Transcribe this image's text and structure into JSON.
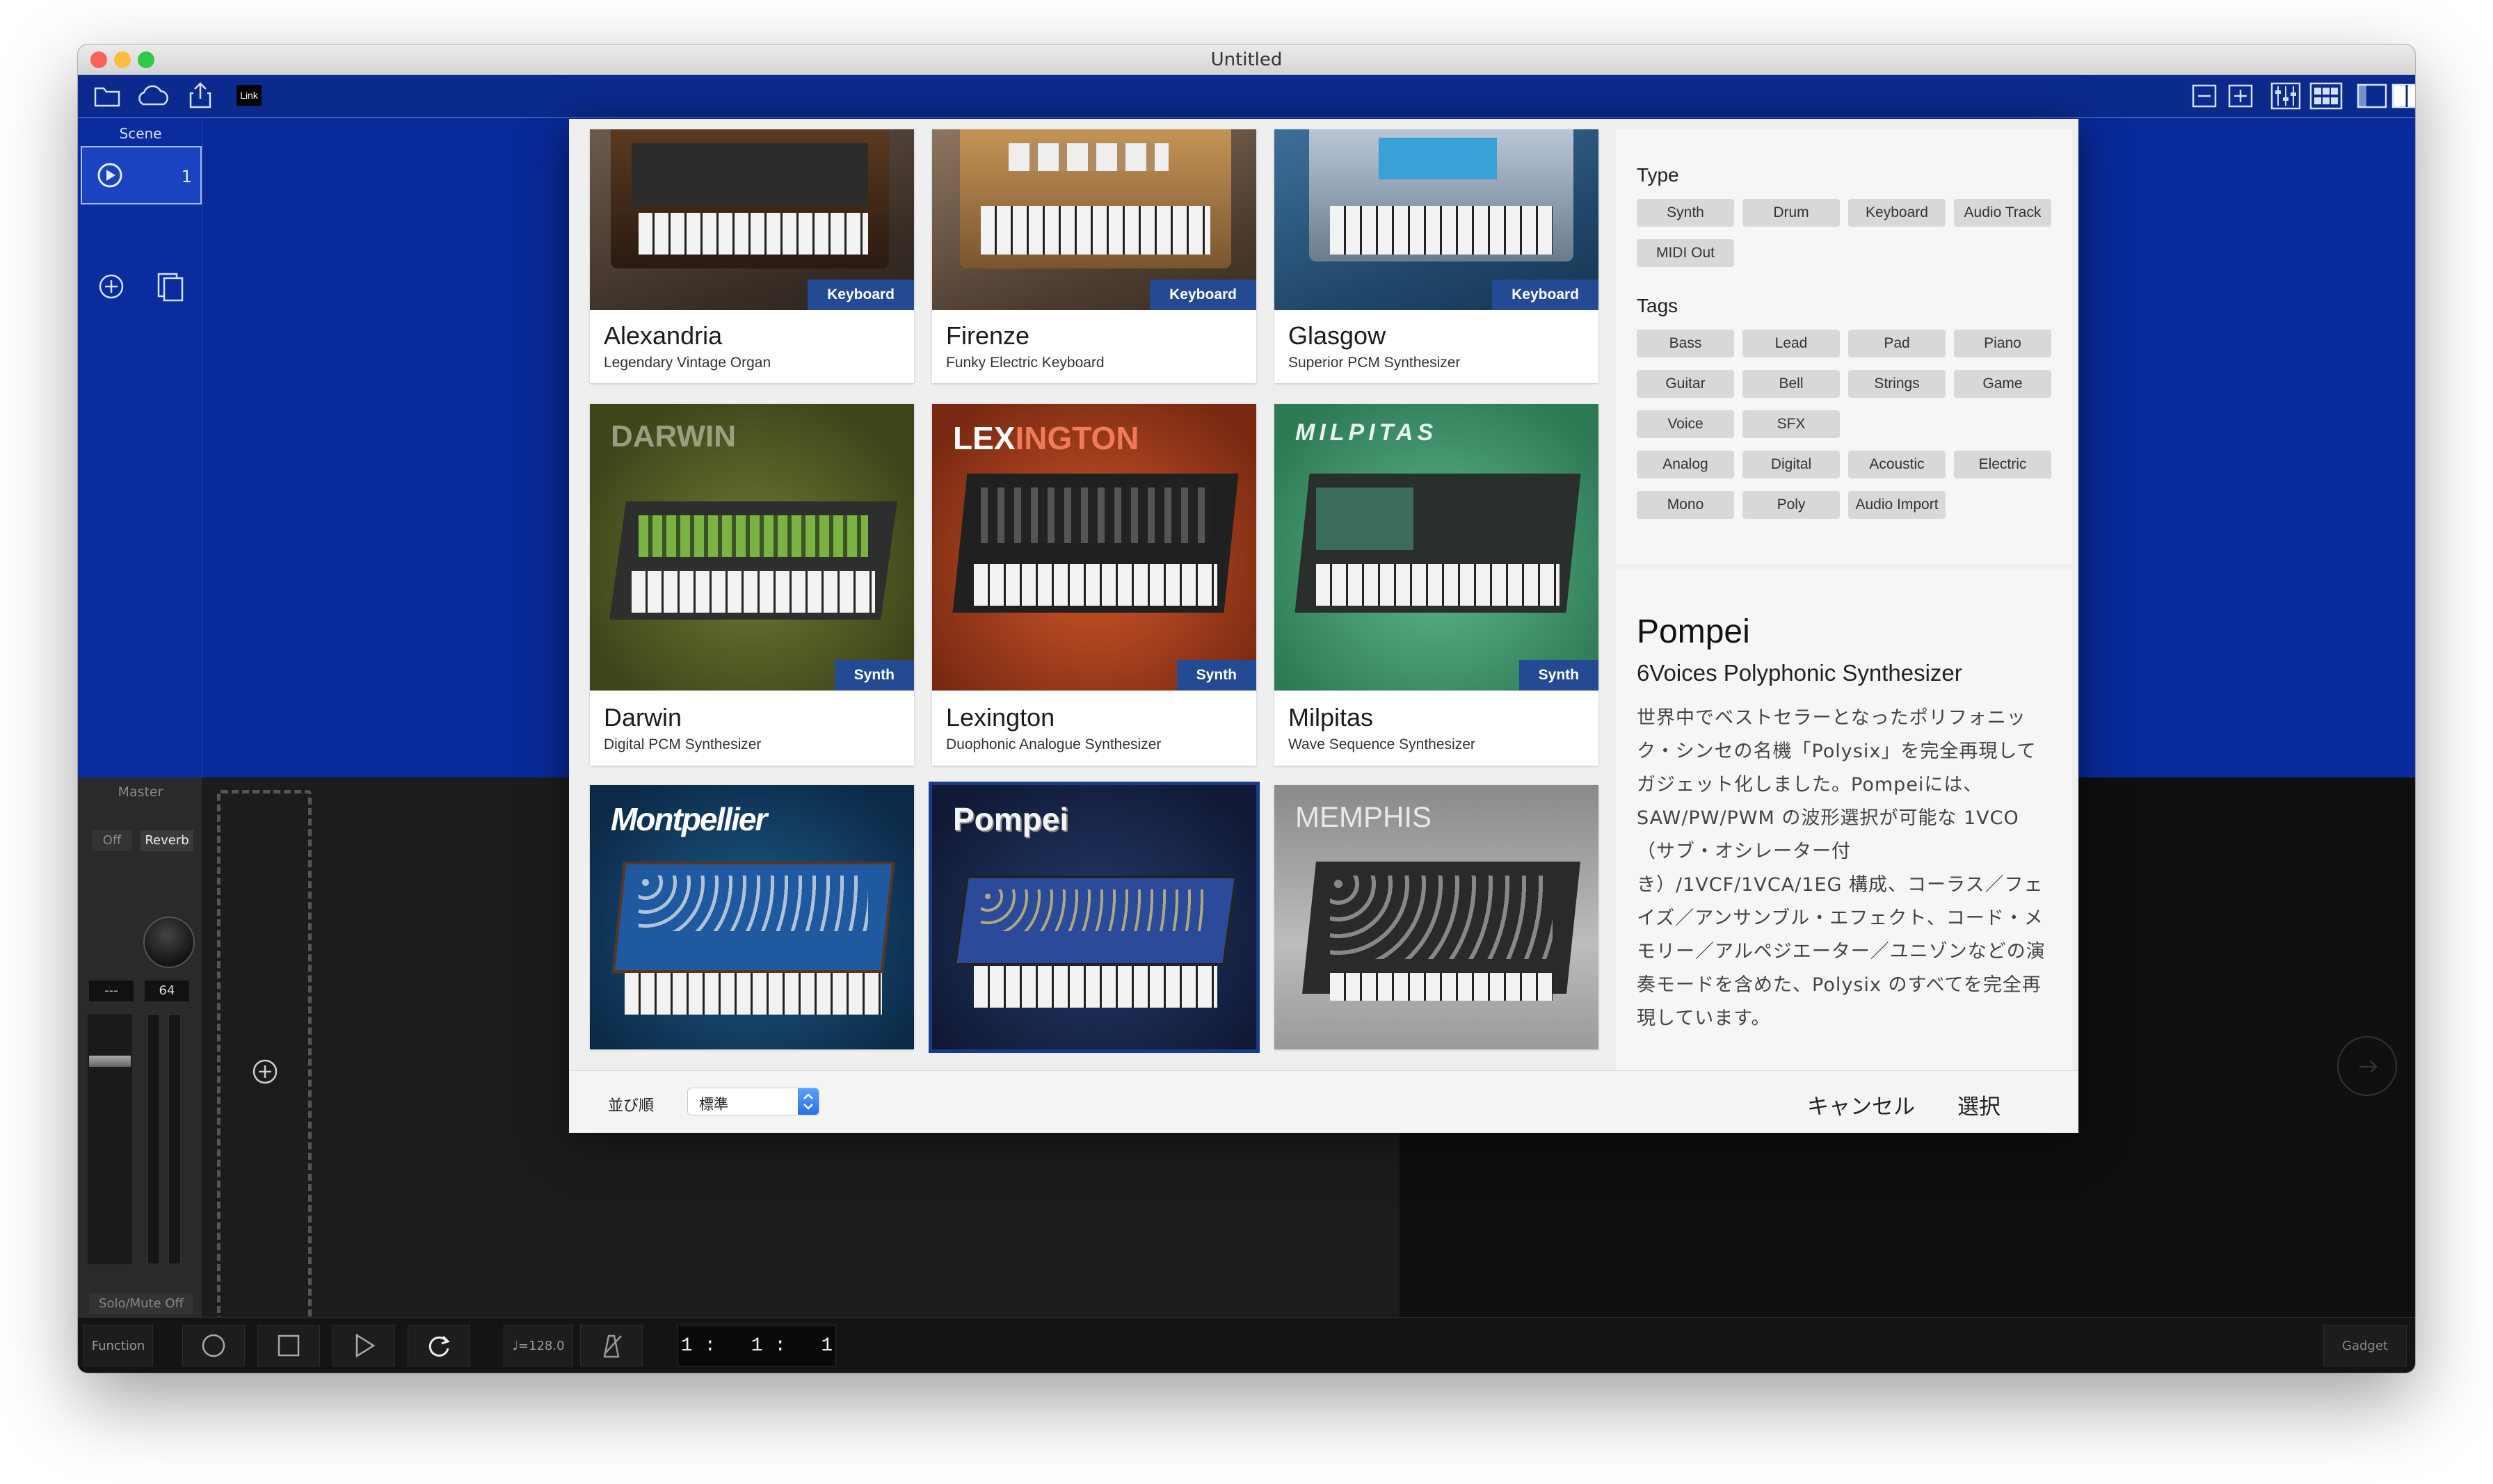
{
  "window": {
    "title": "Untitled",
    "traffic_lights": {
      "close": "#fc605b",
      "minimize": "#fdbc40",
      "zoom": "#34c84a"
    }
  },
  "toolbar": {
    "link_label": "Link",
    "left_icons": [
      "folder-icon",
      "cloud-icon",
      "share-icon"
    ],
    "right_icons": [
      "zoom-out-icon",
      "zoom-in-icon",
      "mixer-icon",
      "grid-icon",
      "left-panel-icon",
      "split-panel-icon",
      "right-panel-icon"
    ]
  },
  "scenes": {
    "header": "Scene",
    "items": [
      {
        "number": "1"
      }
    ]
  },
  "master": {
    "title": "Master",
    "off_label": "Off",
    "reverb_label": "Reverb",
    "left_value": "---",
    "right_value": "64",
    "solo_mute_label": "Solo/Mute Off"
  },
  "transport": {
    "function_label": "Function",
    "tempo": "♩=128.0",
    "position": "1 :   1 :   1",
    "gadget_label": "Gadget"
  },
  "browser": {
    "cards": [
      {
        "name": "Alexandria",
        "subtitle": "Legendary Vintage Organ",
        "badge": "Keyboard"
      },
      {
        "name": "Firenze",
        "subtitle": "Funky Electric Keyboard",
        "badge": "Keyboard"
      },
      {
        "name": "Glasgow",
        "subtitle": "Superior PCM Synthesizer",
        "badge": "Keyboard"
      },
      {
        "name": "Darwin",
        "subtitle": "Digital PCM Synthesizer",
        "badge": "Synth",
        "logo": "DARWIN"
      },
      {
        "name": "Lexington",
        "subtitle": "Duophonic Analogue Synthesizer",
        "badge": "Synth",
        "logo_a": "LEX",
        "logo_b": "INGTON"
      },
      {
        "name": "Milpitas",
        "subtitle": "Wave Sequence Synthesizer",
        "badge": "Synth",
        "logo": "MILPITAS"
      },
      {
        "logo": "Montpellier"
      },
      {
        "logo": "Pompei"
      },
      {
        "logo": "MEMPHIS"
      }
    ]
  },
  "filters": {
    "type_heading": "Type",
    "type_buttons": [
      "Synth",
      "Drum",
      "Keyboard",
      "Audio Track",
      "MIDI Out"
    ],
    "tags_heading": "Tags",
    "tag_buttons": [
      "Bass",
      "Lead",
      "Pad",
      "Piano",
      "Guitar",
      "Bell",
      "Strings",
      "Game",
      "Voice",
      "SFX",
      "Analog",
      "Digital",
      "Acoustic",
      "Electric",
      "Mono",
      "Poly",
      "Audio Import"
    ]
  },
  "detail": {
    "name": "Pompei",
    "subtitle": "6Voices Polyphonic Synthesizer",
    "description": "世界中でベストセラーとなったポリフォニック・シンセの名機「Polysix」を完全再現してガジェット化しました。Pompeiには、SAW/PW/PWM の波形選択が可能な 1VCO（サブ・オシレーター付き）/1VCF/1VCA/1EG 構成、コーラス／フェイズ／アンサンブル・エフェクト、コード・メモリー／アルペジエーター／ユニゾンなどの演奏モードを含めた、Polysix のすべてを完全再現しています。"
  },
  "footer": {
    "sort_label": "並び順",
    "sort_value": "標準",
    "cancel_label": "キャンセル",
    "select_label": "選択"
  }
}
